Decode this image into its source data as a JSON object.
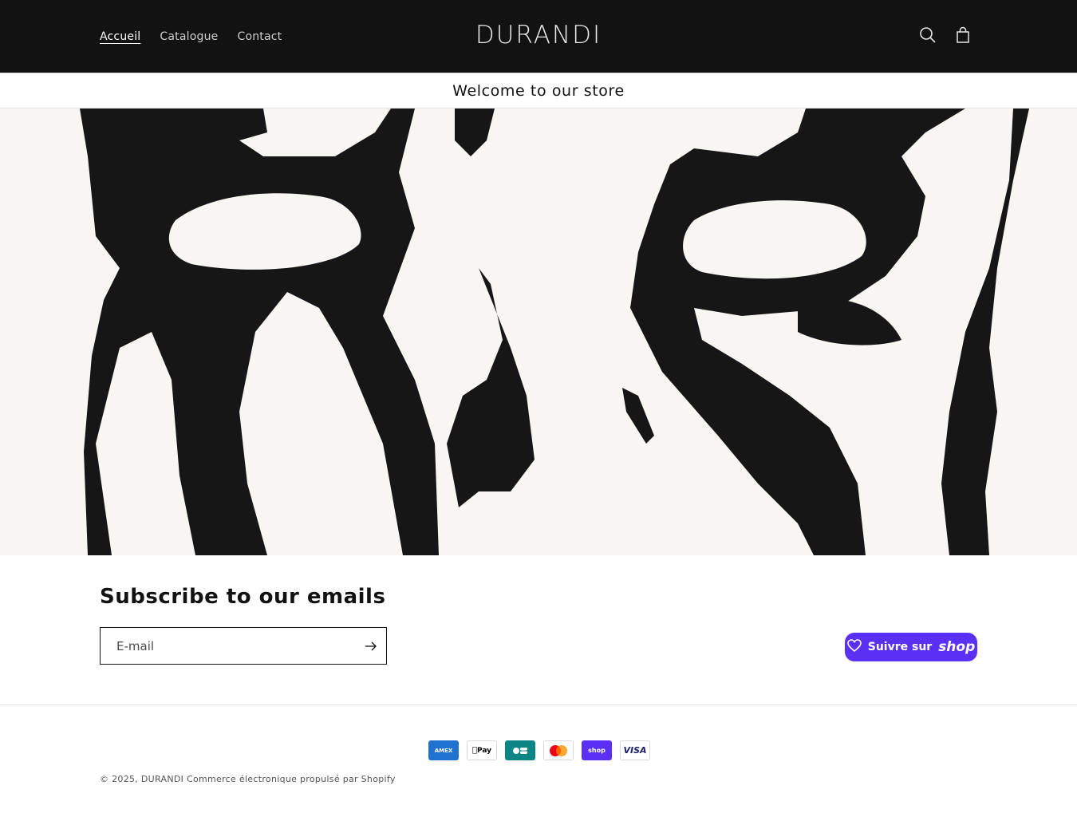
{
  "header": {
    "nav": [
      {
        "label": "Accueil",
        "active": true
      },
      {
        "label": "Catalogue",
        "active": false
      },
      {
        "label": "Contact",
        "active": false
      }
    ],
    "logo": "DURANDI",
    "icons": [
      "search-icon",
      "cart-icon"
    ]
  },
  "announcement": "Welcome to our store",
  "hero": {
    "image": "abstract black ink illustration of two eyes on cream background"
  },
  "newsletter": {
    "title": "Subscribe to our emails",
    "placeholder": "E-mail",
    "value": "",
    "submit_icon": "arrow-right-icon"
  },
  "shop_follow": {
    "label": "Suivre sur",
    "brand": "shop"
  },
  "payments": [
    {
      "name": "American Express",
      "short": "AMEX"
    },
    {
      "name": "Apple Pay",
      "short": "Pay"
    },
    {
      "name": "Cartes Bancaires",
      "short": ""
    },
    {
      "name": "Mastercard",
      "short": ""
    },
    {
      "name": "Shop Pay",
      "short": "shop"
    },
    {
      "name": "Visa",
      "short": "VISA"
    }
  ],
  "footer": {
    "copyright_prefix": "© 2025,",
    "store_link": "DURANDI",
    "powered": "Commerce électronique propulsé par Shopify"
  },
  "colors": {
    "header_bg": "#121212",
    "shop_purple": "#5a31f4",
    "hero_bg": "#f7f6f2"
  }
}
